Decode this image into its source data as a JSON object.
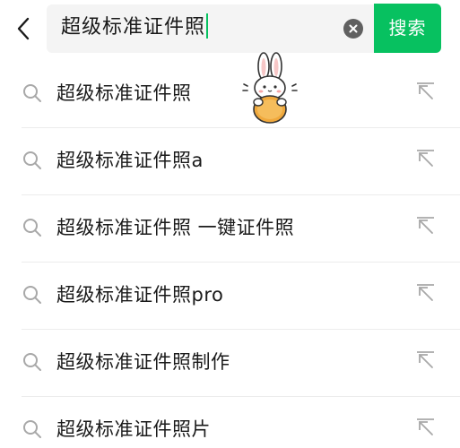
{
  "search": {
    "query": "超级标准证件照",
    "button_label": "搜索"
  },
  "suggestions": [
    {
      "text": "超级标准证件照"
    },
    {
      "text": "超级标准证件照a"
    },
    {
      "text": "超级标准证件照 一键证件照"
    },
    {
      "text": "超级标准证件照pro"
    },
    {
      "text": "超级标准证件照制作"
    },
    {
      "text": "超级标准证件照片"
    }
  ],
  "icons": {
    "back": "chevron-left-icon",
    "clear": "clear-circle-icon",
    "suggestion": "search-icon",
    "fill": "arrow-up-left-icon",
    "sticker": "bunny-sticker"
  },
  "colors": {
    "accent": "#07c160",
    "search_bg": "#f4f4f4",
    "icon_gray": "#a8a8a8",
    "text": "#1a1a1a",
    "divider": "#ececec"
  }
}
